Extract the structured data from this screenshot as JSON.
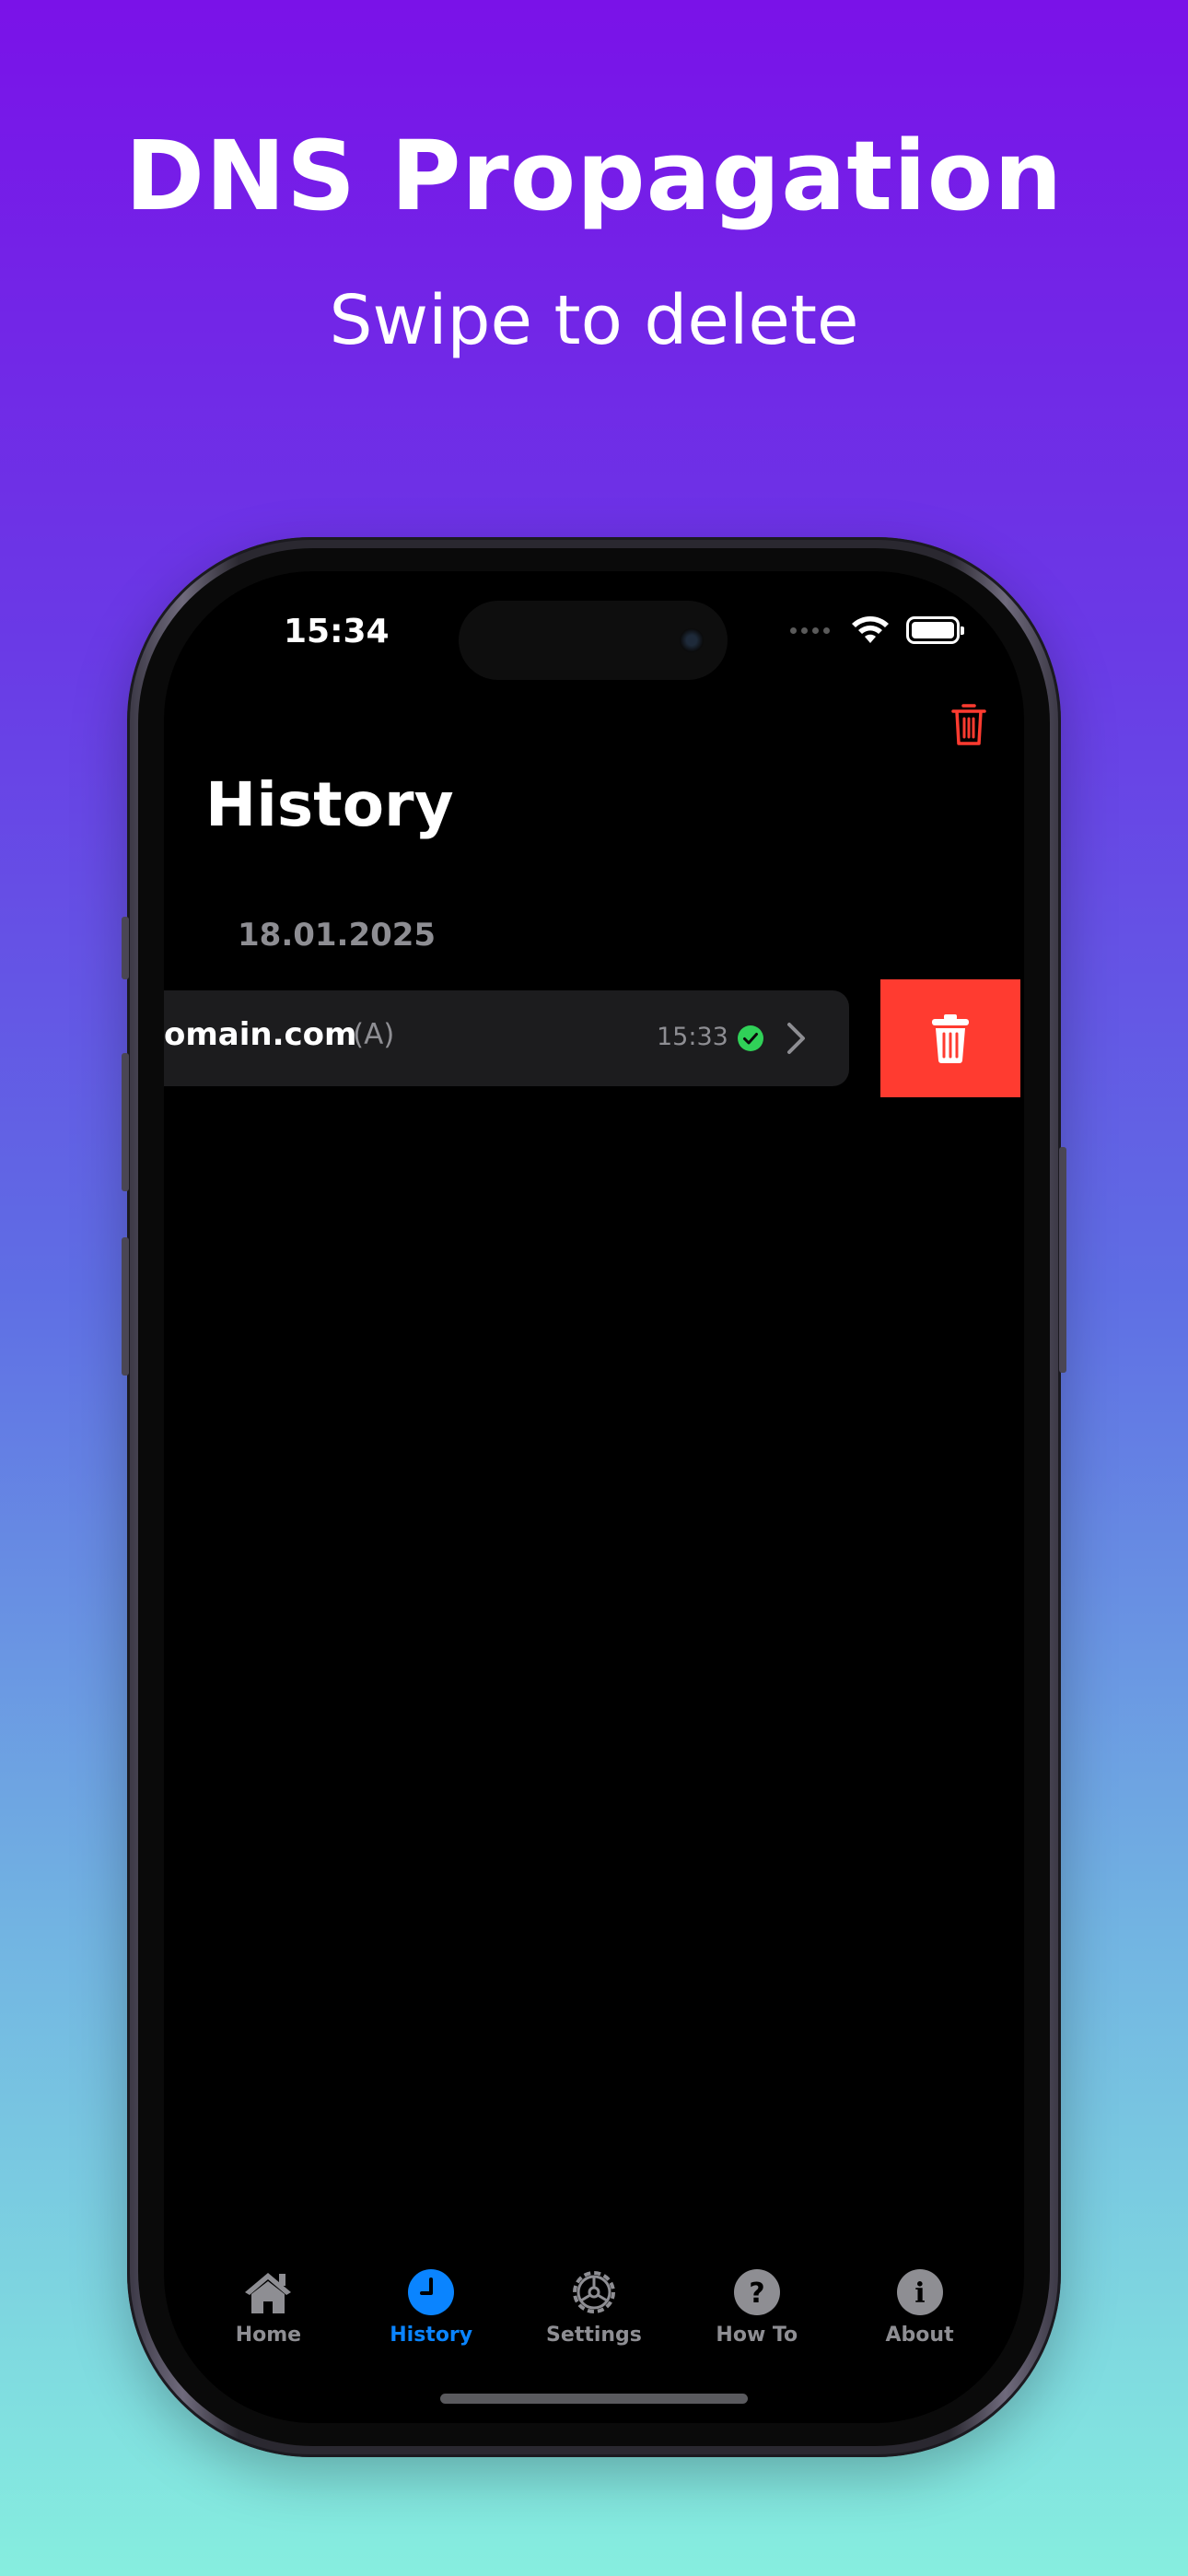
{
  "promo": {
    "headline": "DNS Propagation",
    "subheadline": "Swipe to delete"
  },
  "status_bar": {
    "time": "15:34",
    "wifi_icon": "wifi-icon",
    "battery_icon": "battery-icon"
  },
  "nav": {
    "title": "History",
    "trash_icon": "trash-icon",
    "trash_color": "#ff3b30"
  },
  "history": {
    "sections": [
      {
        "date": "18.01.2025",
        "rows": [
          {
            "domain": "omain.com",
            "type": "(A)",
            "time": "15:33",
            "status_icon": "check-circle-icon",
            "status_color": "#30d158"
          }
        ]
      }
    ],
    "delete_action_color": "#ff3b30"
  },
  "tab_bar": {
    "active_color": "#0a84ff",
    "inactive_color": "#8e8e93",
    "tabs": [
      {
        "label": "Home",
        "icon": "house-icon"
      },
      {
        "label": "History",
        "icon": "clock-icon",
        "active": true
      },
      {
        "label": "Settings",
        "icon": "gear-icon"
      },
      {
        "label": "How To",
        "icon": "question-icon"
      },
      {
        "label": "About",
        "icon": "info-icon"
      }
    ]
  }
}
